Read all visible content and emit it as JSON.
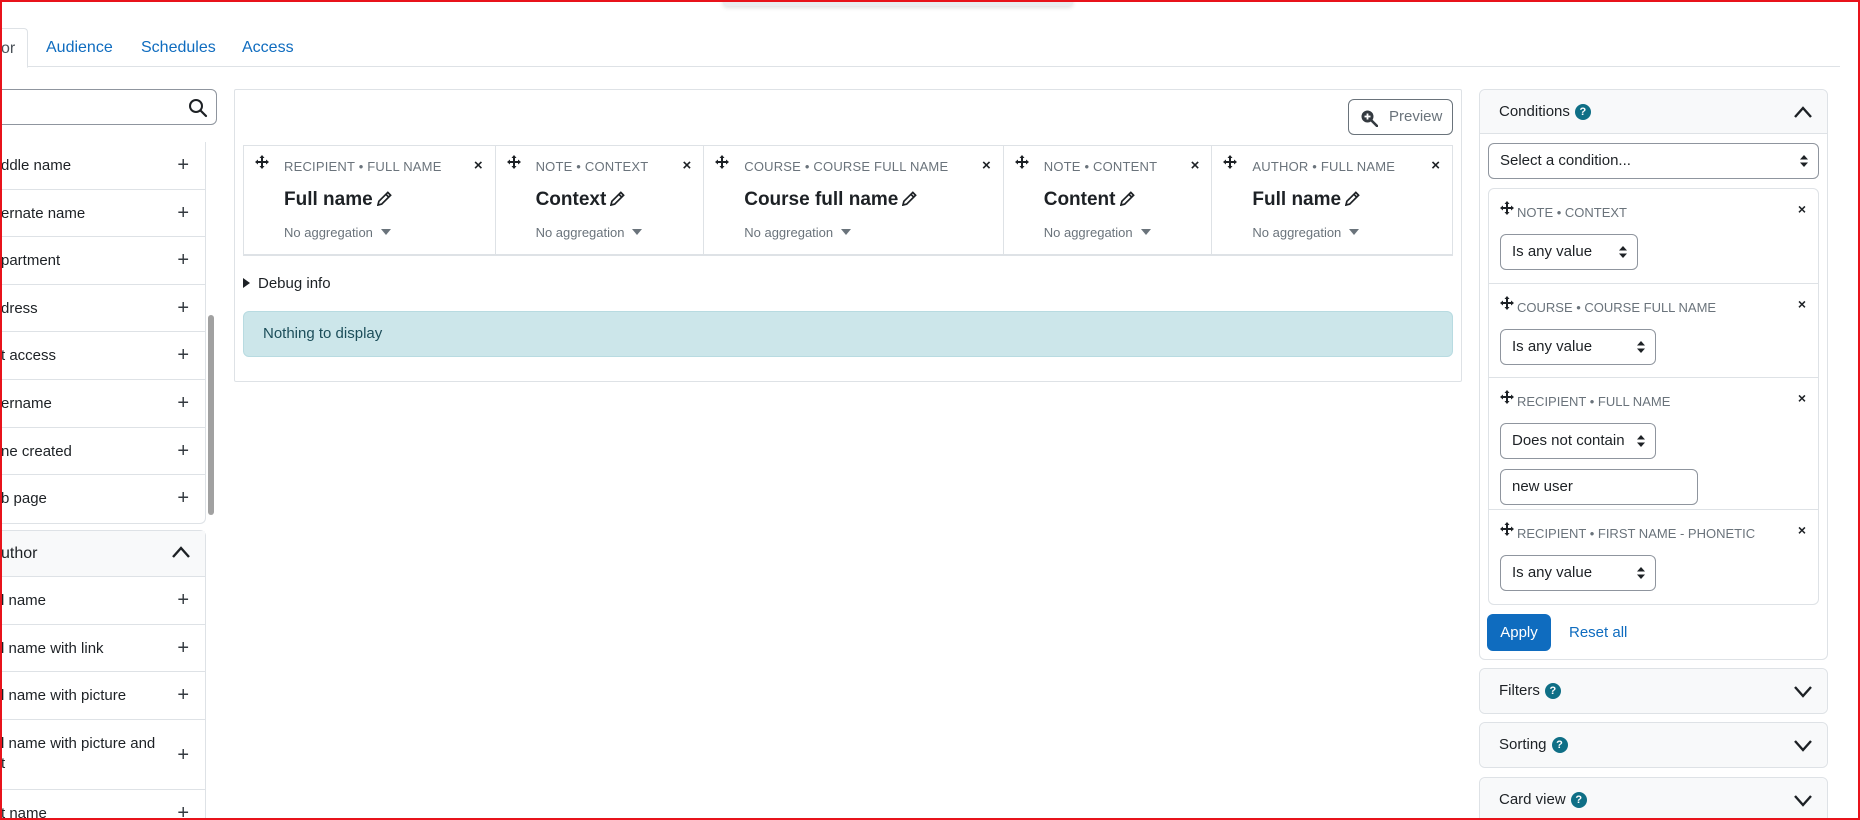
{
  "tabs": [
    {
      "label": "or",
      "active": true
    },
    {
      "label": "Audience"
    },
    {
      "label": "Schedules"
    },
    {
      "label": "Access"
    }
  ],
  "sidebar": {
    "group1_items": [
      {
        "label": "ddle name"
      },
      {
        "label": "ernate name"
      },
      {
        "label": "partment"
      },
      {
        "label": "dress"
      },
      {
        "label": "t access"
      },
      {
        "label": "ername"
      },
      {
        "label": "ne created"
      },
      {
        "label": "b page"
      }
    ],
    "group2": {
      "title": "uthor",
      "items": [
        {
          "label": "l name"
        },
        {
          "label": "l name with link"
        },
        {
          "label": "l name with picture"
        },
        {
          "label": "l name with picture and t"
        },
        {
          "label": "t name"
        }
      ]
    },
    "plus_glyph": "+"
  },
  "main": {
    "preview_label": "Preview",
    "columns": [
      {
        "kicker": "RECIPIENT • FULL NAME",
        "title": "Full name",
        "aggregation": "No aggregation"
      },
      {
        "kicker": "NOTE • CONTEXT",
        "title": "Context",
        "aggregation": "No aggregation"
      },
      {
        "kicker": "COURSE • COURSE FULL NAME",
        "title": "Course full name",
        "aggregation": "No aggregation"
      },
      {
        "kicker": "NOTE • CONTENT",
        "title": "Content",
        "aggregation": "No aggregation"
      },
      {
        "kicker": "AUTHOR • FULL NAME",
        "title": "Full name",
        "aggregation": "No aggregation"
      }
    ],
    "debug_label": "Debug info",
    "empty_message": "Nothing to display"
  },
  "conditions": {
    "title": "Conditions",
    "select_placeholder": "Select a condition...",
    "items": [
      {
        "kicker": "NOTE • CONTEXT",
        "operator": "Is any value"
      },
      {
        "kicker": "COURSE • COURSE FULL NAME",
        "operator": "Is any value"
      },
      {
        "kicker": "RECIPIENT • FULL NAME",
        "operator": "Does not contain",
        "value": "new user"
      },
      {
        "kicker": "RECIPIENT • FIRST NAME - PHONETIC",
        "operator": "Is any value"
      }
    ],
    "apply_label": "Apply",
    "reset_label": "Reset all"
  },
  "filters": {
    "title": "Filters"
  },
  "sorting": {
    "title": "Sorting"
  },
  "card_view": {
    "title": "Card view"
  },
  "help_glyph": "?",
  "close_glyph": "×",
  "colors": {
    "primary": "#0f6cbf",
    "help": "#0f6f86",
    "alert_bg": "#cce6ea",
    "frame": "#e8131b"
  }
}
